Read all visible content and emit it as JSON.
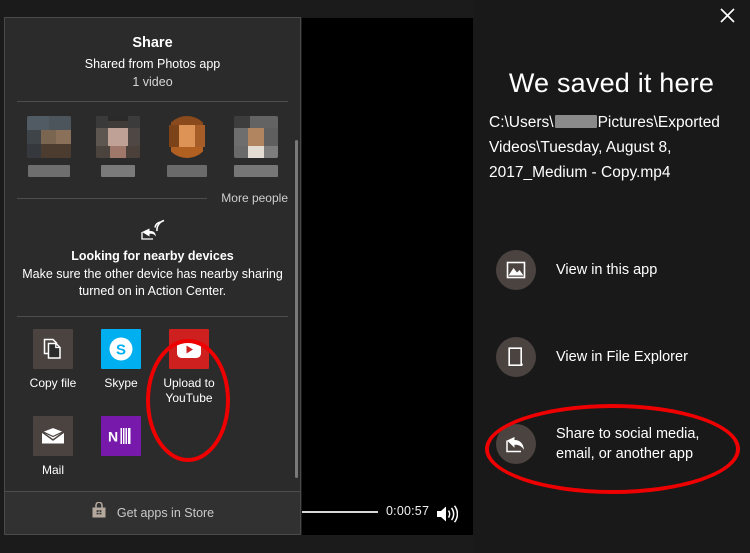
{
  "window": {
    "close_icon": "close-icon"
  },
  "video_player": {
    "time_label": "0:00:57",
    "volume_icon": "volume-high-icon",
    "seek_icon": "seek-bar"
  },
  "right_pane": {
    "title": "We saved it here",
    "path_prefix": "C:\\Users\\",
    "path_redacted": true,
    "path_suffix": "Pictures\\Exported Videos\\Tuesday, August 8, 2017_Medium - Copy.mp4",
    "actions": [
      {
        "label": "View in this app",
        "icon": "photo-icon"
      },
      {
        "label": "View in File Explorer",
        "icon": "folder-document-icon"
      },
      {
        "label": "Share to social media, email, or another app",
        "icon": "share-icon"
      }
    ]
  },
  "share_flyout": {
    "title": "Share",
    "subtitle": "Shared from Photos app",
    "count": "1 video",
    "contacts": [
      {
        "name_redacted": true
      },
      {
        "name_redacted": true
      },
      {
        "name_redacted": true
      },
      {
        "name_redacted": true
      }
    ],
    "more_people": "More people",
    "nearby": {
      "icon": "nearby-share-icon",
      "title": "Looking for nearby devices",
      "description": "Make sure the other device has nearby sharing turned on in Action Center."
    },
    "apps": [
      {
        "label": "Copy file",
        "icon": "copy-file-icon",
        "style": "generic"
      },
      {
        "label": "Skype",
        "icon": "skype-icon",
        "style": "skype"
      },
      {
        "label": "Upload to YouTube",
        "icon": "youtube-icon",
        "style": "youtube"
      },
      {
        "label": "Mail",
        "icon": "mail-icon",
        "style": "generic"
      },
      {
        "label": "",
        "icon": "onenote-icon",
        "style": "onenote"
      }
    ],
    "store_link": "Get apps in Store",
    "store_icon": "store-bag-icon"
  },
  "annotations": {
    "color": "#ee0000",
    "items": [
      {
        "name": "annotation-circle-upload-to-youtube"
      },
      {
        "name": "annotation-circle-share-to-social-media"
      }
    ]
  }
}
